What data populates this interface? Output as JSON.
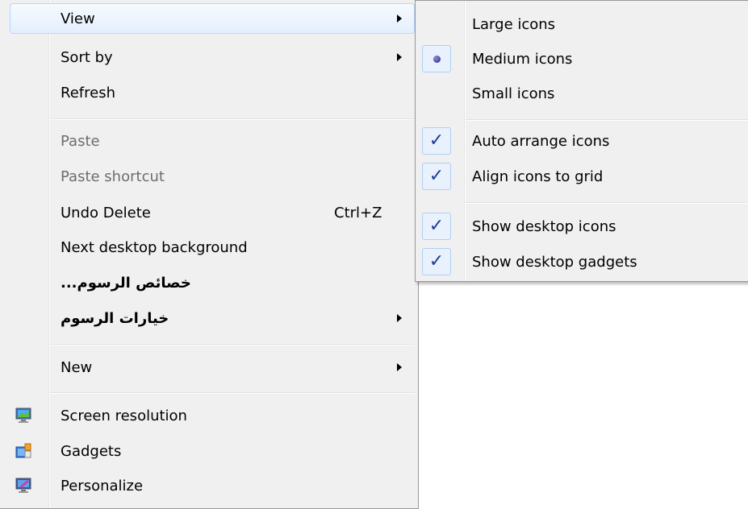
{
  "main_menu": {
    "items": [
      {
        "label": "View",
        "has_submenu": true,
        "highlighted": true
      },
      {
        "label": "Sort by",
        "has_submenu": true
      },
      {
        "label": "Refresh"
      },
      {
        "label": "Paste",
        "disabled": true
      },
      {
        "label": "Paste shortcut",
        "disabled": true
      },
      {
        "label": "Undo Delete",
        "shortcut": "Ctrl+Z"
      },
      {
        "label": "Next desktop background"
      },
      {
        "label": "...خصائص الرسوم"
      },
      {
        "label": "خيارات الرسوم",
        "has_submenu": true
      },
      {
        "label": "New",
        "has_submenu": true
      },
      {
        "label": "Screen resolution",
        "icon": "monitor-icon"
      },
      {
        "label": "Gadgets",
        "icon": "gadgets-icon"
      },
      {
        "label": "Personalize",
        "icon": "personalize-icon"
      }
    ]
  },
  "view_submenu": {
    "items": [
      {
        "label": "Large icons"
      },
      {
        "label": "Medium icons",
        "marker": "radio"
      },
      {
        "label": "Small icons"
      },
      {
        "label": "Auto arrange icons",
        "marker": "check"
      },
      {
        "label": "Align icons to grid",
        "marker": "check"
      },
      {
        "label": "Show desktop icons",
        "marker": "check"
      },
      {
        "label": "Show desktop gadgets",
        "marker": "check"
      }
    ]
  },
  "glyphs": {
    "check": "✓"
  },
  "colors": {
    "highlight_border": "#b8d6fb",
    "menu_bg": "#f0f0f0",
    "check": "#1c3d9b",
    "disabled_text": "#6d6d6d"
  }
}
